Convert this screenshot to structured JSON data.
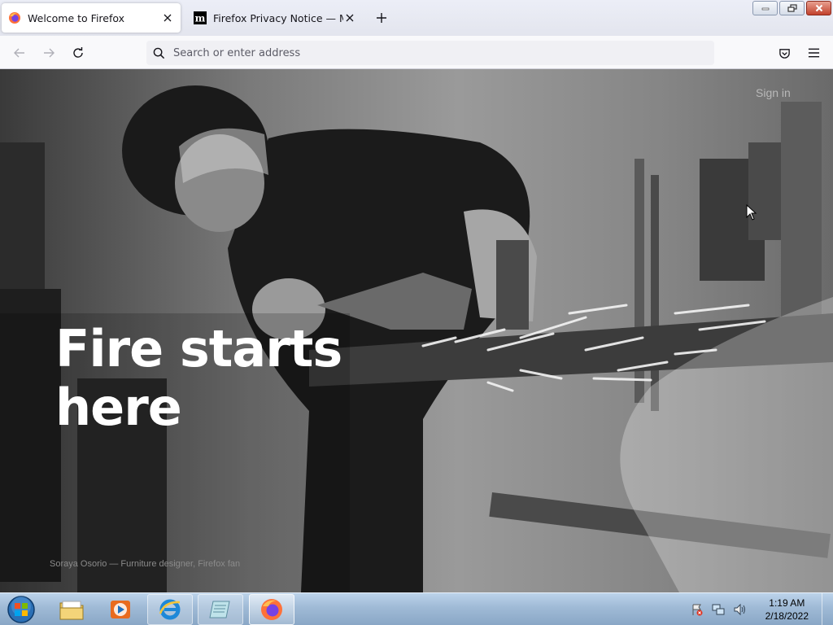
{
  "browser": {
    "tabs": [
      {
        "title": "Welcome to Firefox",
        "active": true,
        "favicon": "firefox-icon"
      },
      {
        "title": "Firefox Privacy Notice — Mozilla",
        "active": false,
        "favicon": "mozilla-m-icon"
      }
    ],
    "new_tab_icon": "plus-icon",
    "window_controls": [
      "minimize-icon",
      "restore-icon",
      "close-icon"
    ],
    "nav": {
      "back_icon": "back-arrow-icon",
      "forward_icon": "forward-arrow-icon",
      "reload_icon": "reload-icon",
      "url_placeholder": "Search or enter address",
      "url_value": "",
      "pocket_icon": "pocket-icon",
      "menu_icon": "hamburger-menu-icon"
    }
  },
  "page": {
    "headline": "Fire starts here",
    "sign_in": "Sign in",
    "photo_credit": "Soraya Osorio — Furniture designer, Firefox fan"
  },
  "taskbar": {
    "start_icon": "windows-start-orb-icon",
    "items": [
      {
        "name": "file-explorer-icon",
        "running": false
      },
      {
        "name": "media-player-icon",
        "running": false
      },
      {
        "name": "internet-explorer-icon",
        "running": false
      },
      {
        "name": "notepad-icon",
        "running": false
      },
      {
        "name": "firefox-icon",
        "running": true
      }
    ],
    "tray_icons": [
      "action-center-flag-icon",
      "network-icon",
      "volume-icon"
    ],
    "clock": {
      "time": "1:19 AM",
      "date": "2/18/2022"
    }
  }
}
